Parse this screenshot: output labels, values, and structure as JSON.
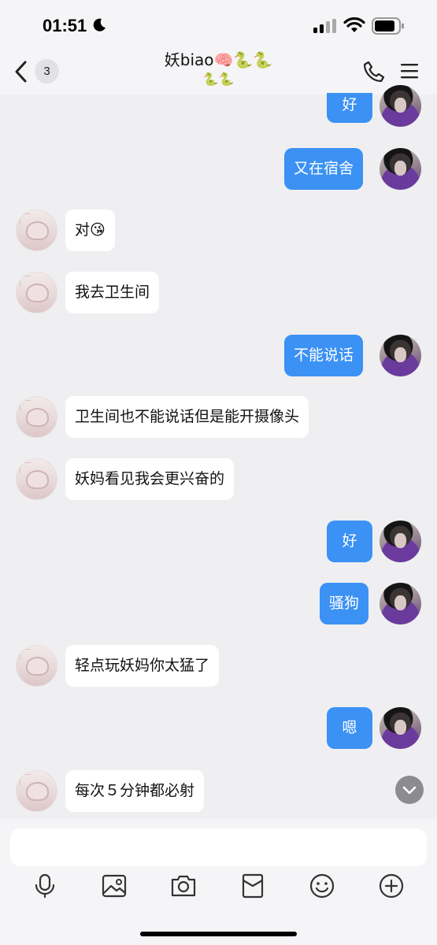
{
  "status_bar": {
    "time": "01:51"
  },
  "header": {
    "unread_count": "3",
    "title": "妖biao🧠🐍🐍",
    "title_line2": "🐍🐍"
  },
  "messages": [
    {
      "side": "out",
      "text": "好"
    },
    {
      "side": "out",
      "text": "又在宿舍"
    },
    {
      "side": "in",
      "text": "对😘"
    },
    {
      "side": "in",
      "text": "我去卫生间"
    },
    {
      "side": "out",
      "text": "不能说话"
    },
    {
      "side": "in",
      "text": "卫生间也不能说话但是能开摄像头"
    },
    {
      "side": "in",
      "text": "妖妈看见我会更兴奋的"
    },
    {
      "side": "out",
      "text": "好"
    },
    {
      "side": "out",
      "text": "骚狗"
    },
    {
      "side": "in",
      "text": "轻点玩妖妈你太猛了"
    },
    {
      "side": "out",
      "text": "嗯"
    },
    {
      "side": "in",
      "text": "每次５分钟都必射"
    }
  ],
  "input": {
    "value": ""
  },
  "toolbar": {
    "icons": [
      "microphone-icon",
      "image-icon",
      "camera-icon",
      "red-packet-icon",
      "emoji-icon",
      "plus-icon"
    ]
  },
  "colors": {
    "outgoing_bubble": "#3b91f4",
    "incoming_bubble": "#ffffff",
    "background": "#efeff1"
  }
}
